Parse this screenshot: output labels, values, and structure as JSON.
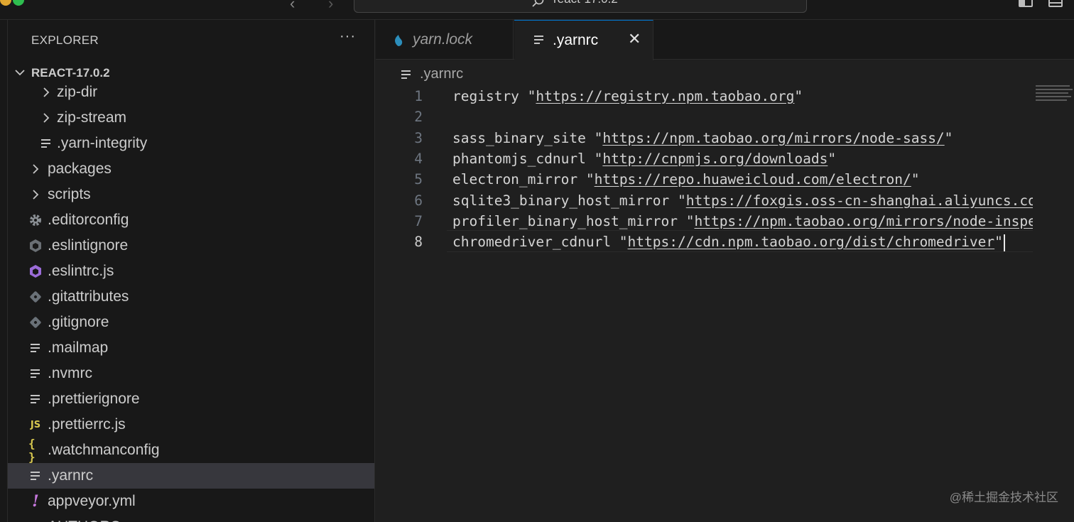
{
  "titlebar": {
    "search_text": "react-17.0.2",
    "back_icon": "chevron-left-icon",
    "forward_icon": "chevron-right-icon"
  },
  "sidebar": {
    "title": "EXPLORER",
    "more_label": "···",
    "root_folder": "REACT-17.0.2",
    "items": [
      {
        "label": "zip-dir",
        "icon": "chevron-right-icon",
        "kind": "folder"
      },
      {
        "label": "zip-stream",
        "icon": "chevron-right-icon",
        "kind": "folder"
      },
      {
        "label": ".yarn-integrity",
        "icon": "text-file-icon",
        "kind": "file"
      },
      {
        "label": "packages",
        "icon": "chevron-right-icon",
        "kind": "folder"
      },
      {
        "label": "scripts",
        "icon": "chevron-right-icon",
        "kind": "folder"
      },
      {
        "label": ".editorconfig",
        "icon": "gear-icon",
        "kind": "file"
      },
      {
        "label": ".eslintignore",
        "icon": "eslint-icon",
        "kind": "file"
      },
      {
        "label": ".eslintrc.js",
        "icon": "eslint-icon",
        "kind": "file"
      },
      {
        "label": ".gitattributes",
        "icon": "git-icon",
        "kind": "file"
      },
      {
        "label": ".gitignore",
        "icon": "git-icon",
        "kind": "file"
      },
      {
        "label": ".mailmap",
        "icon": "text-file-icon",
        "kind": "file"
      },
      {
        "label": ".nvmrc",
        "icon": "text-file-icon",
        "kind": "file"
      },
      {
        "label": ".prettierignore",
        "icon": "text-file-icon",
        "kind": "file"
      },
      {
        "label": ".prettierrc.js",
        "icon": "js-icon",
        "kind": "file",
        "glyph": "JS"
      },
      {
        "label": ".watchmanconfig",
        "icon": "json-braces-icon",
        "kind": "file",
        "glyph": "{}"
      },
      {
        "label": ".yarnrc",
        "icon": "text-file-icon",
        "kind": "file",
        "selected": true
      },
      {
        "label": "appveyor.yml",
        "icon": "yaml-icon",
        "kind": "file",
        "glyph": "!"
      },
      {
        "label": "AUTHORS",
        "icon": "text-file-icon",
        "kind": "file"
      }
    ]
  },
  "editor": {
    "tabs": [
      {
        "label": "yarn.lock",
        "icon": "yarn-icon",
        "active": false
      },
      {
        "label": ".yarnrc",
        "icon": "text-file-icon",
        "active": true,
        "close_label": "✕"
      }
    ],
    "breadcrumb": ".yarnrc",
    "current_line": 8,
    "lines": [
      {
        "num": "1",
        "key": "registry",
        "url": "https://registry.npm.taobao.org"
      },
      {
        "num": "2",
        "key": "",
        "url": ""
      },
      {
        "num": "3",
        "key": "sass_binary_site",
        "url": "https://npm.taobao.org/mirrors/node-sass/"
      },
      {
        "num": "4",
        "key": "phantomjs_cdnurl",
        "url": "http://cnpmjs.org/downloads"
      },
      {
        "num": "5",
        "key": "electron_mirror",
        "url": "https://repo.huaweicloud.com/electron/"
      },
      {
        "num": "6",
        "key": "sqlite3_binary_host_mirror",
        "url": "https://foxgis.oss-cn-shanghai.aliyuncs.com/"
      },
      {
        "num": "7",
        "key": "profiler_binary_host_mirror",
        "url": "https://npm.taobao.org/mirrors/node-inspector/"
      },
      {
        "num": "8",
        "key": "chromedriver_cdnurl",
        "url": "https://cdn.npm.taobao.org/dist/chromedriver"
      }
    ]
  },
  "watermark": "@稀土掘金技术社区",
  "colors": {
    "accent": "#0078d4",
    "sidebar_bg": "#181818",
    "editor_bg": "#1f1f1f",
    "selected_bg": "#37373d",
    "js_yellow": "#d8c84f",
    "eslint_purple": "#9b6cd8"
  }
}
